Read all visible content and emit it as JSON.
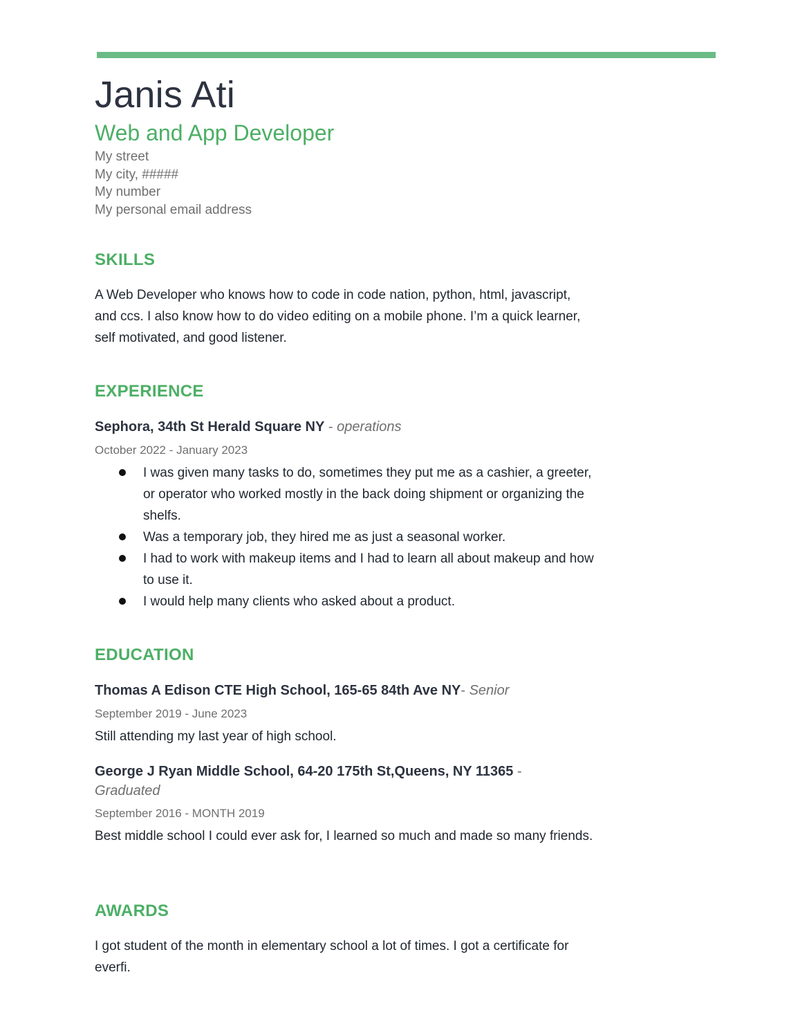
{
  "header": {
    "name": "Janis Ati",
    "title": "Web and App Developer",
    "contact": {
      "street": "My street",
      "city": "My city, #####",
      "phone": "My number",
      "email": "My personal email address"
    },
    "accent_color": "#6bbb86"
  },
  "skills": {
    "heading": "SKILLS",
    "text": "A Web Developer who knows how to code in code nation, python, html, javascript, and ccs. I also know how to do video editing on a mobile phone. I’m a quick learner, self motivated, and good listener."
  },
  "experience": {
    "heading": "EXPERIENCE",
    "jobs": [
      {
        "employer": "Sephora,  34th St Herald Square NY",
        "separator": " - ",
        "role": "operations",
        "dates": "October  2022 - January 2023",
        "bullets": [
          "I was given many tasks to do, sometimes they put me as a cashier, a greeter, or operator who worked mostly in the back doing shipment or organizing the shelfs.",
          "Was a temporary job, they hired me as just a seasonal worker.",
          "I had to work with makeup items and I had to learn all about makeup and how to use it.",
          "I would help many clients who asked about a product."
        ]
      }
    ]
  },
  "education": {
    "heading": "EDUCATION",
    "schools": [
      {
        "school": "Thomas A Edison CTE High School, 165-65 84th Ave NY",
        "separator": "- ",
        "status": "Senior",
        "dates": "September 2019 - June 2023",
        "description": "Still attending my last year of high school."
      },
      {
        "school": "George J Ryan Middle School, 64-20 175th St,Queens, NY 11365",
        "separator": " - ",
        "status": "Graduated",
        "dates": "September 2016 - MONTH 2019",
        "description": "Best middle school I could ever ask for, I learned so much and made so many friends."
      }
    ]
  },
  "awards": {
    "heading": "AWARDS",
    "text": "I got student of the month in elementary school a lot of times. I got a certificate for everfi."
  }
}
